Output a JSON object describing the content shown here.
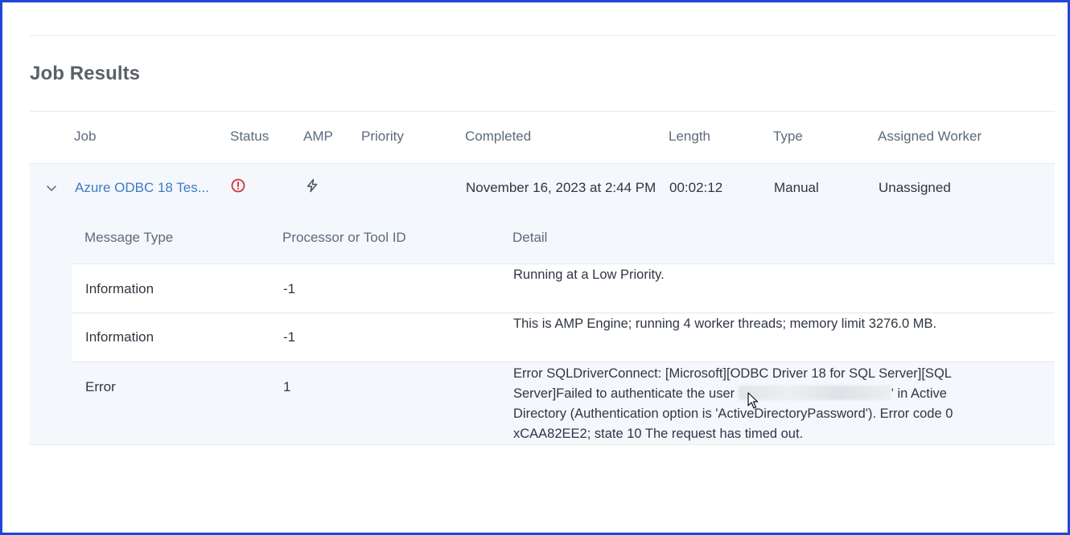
{
  "section": {
    "title": "Job Results"
  },
  "columns": {
    "job": "Job",
    "status": "Status",
    "amp": "AMP",
    "priority": "Priority",
    "completed": "Completed",
    "length": "Length",
    "type": "Type",
    "assigned_worker": "Assigned Worker"
  },
  "job_row": {
    "job_name": "Azure ODBC 18 Tes...",
    "status_icon": "error-circle-icon",
    "amp_icon": "lightning-bolt-icon",
    "priority": "",
    "completed": "November 16, 2023 at 2:44 PM",
    "length": "00:02:12",
    "type": "Manual",
    "assigned_worker": "Unassigned"
  },
  "messages": {
    "columns": {
      "message_type": "Message Type",
      "processor_id": "Processor or Tool ID",
      "detail": "Detail"
    },
    "rows": [
      {
        "type": "Information",
        "id": "-1",
        "detail": "Running at a Low Priority."
      },
      {
        "type": "Information",
        "id": "-1",
        "detail": "This is AMP Engine; running 4 worker threads; memory limit 3276.0 MB."
      },
      {
        "type": "Error",
        "id": "1",
        "detail_before": "Error SQLDriverConnect: [Microsoft][ODBC Driver 18 for SQL Server][SQL Server]Failed to authenticate the user ",
        "detail_after": "' in Active Directory (Authentication option is 'ActiveDirectoryPassword'). Error code 0xCAA82EE2; state 10 The request has timed out."
      }
    ]
  },
  "colors": {
    "frame": "#1f46d6",
    "link": "#3c7cc3",
    "error": "#d1343c",
    "row_bg": "#f4f7fb"
  }
}
